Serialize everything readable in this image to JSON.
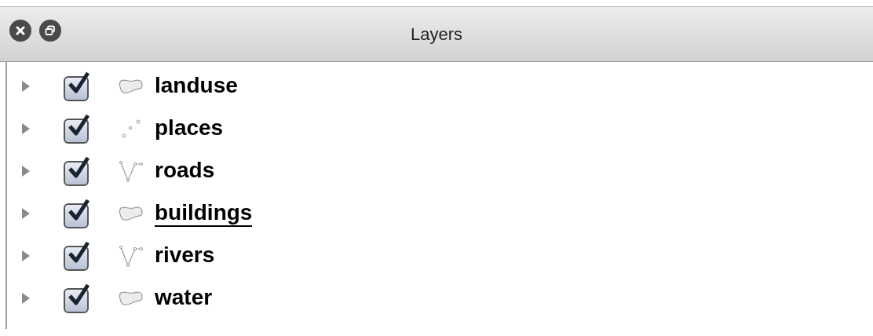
{
  "window": {
    "title": "Layers"
  },
  "layers": [
    {
      "name": "landuse",
      "kind": "polygon",
      "checked": true,
      "expanded": false,
      "selected": false
    },
    {
      "name": "places",
      "kind": "point",
      "checked": true,
      "expanded": false,
      "selected": false
    },
    {
      "name": "roads",
      "kind": "line",
      "checked": true,
      "expanded": false,
      "selected": false
    },
    {
      "name": "buildings",
      "kind": "polygon",
      "checked": true,
      "expanded": false,
      "selected": true
    },
    {
      "name": "rivers",
      "kind": "line",
      "checked": true,
      "expanded": false,
      "selected": false
    },
    {
      "name": "water",
      "kind": "polygon",
      "checked": true,
      "expanded": false,
      "selected": false
    }
  ]
}
